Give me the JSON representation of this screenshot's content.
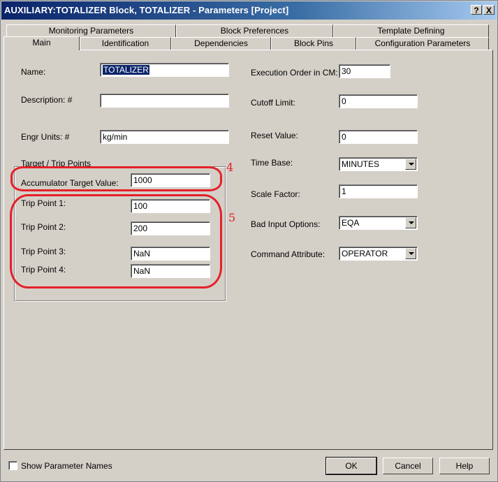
{
  "window": {
    "title": "AUXILIARY:TOTALIZER Block, TOTALIZER - Parameters [Project]",
    "help_button": "?",
    "close_button": "X"
  },
  "tabs": {
    "row_back": [
      "Monitoring Parameters",
      "Block Preferences",
      "Template Defining"
    ],
    "row_front": [
      "Main",
      "Identification",
      "Dependencies",
      "Block Pins",
      "Configuration Parameters"
    ],
    "active": "Main"
  },
  "left": {
    "name_label": "Name:",
    "name_value": "TOTALIZER",
    "description_label": "Description: #",
    "description_value": "",
    "engr_units_label": "Engr Units: #",
    "engr_units_value": "kg/min"
  },
  "target_trip": {
    "group_title": "Target / Trip Points",
    "accumulator_label": "Accumulator Target Value:",
    "accumulator_value": "1000",
    "trip_points": [
      {
        "label": "Trip Point 1:",
        "value": "100"
      },
      {
        "label": "Trip Point 2:",
        "value": "200"
      },
      {
        "label": "Trip Point 3:",
        "value": "NaN"
      },
      {
        "label": "Trip Point 4:",
        "value": "NaN"
      }
    ]
  },
  "right": {
    "exec_order_label": "Execution Order in CM:",
    "exec_order_value": "30",
    "cutoff_label": "Cutoff Limit:",
    "cutoff_value": "0",
    "reset_label": "Reset Value:",
    "reset_value": "0",
    "time_base_label": "Time Base:",
    "time_base_value": "MINUTES",
    "scale_factor_label": "Scale Factor:",
    "scale_factor_value": "1",
    "bad_input_label": "Bad Input Options:",
    "bad_input_value": "EQA",
    "command_attr_label": "Command Attribute:",
    "command_attr_value": "OPERATOR"
  },
  "annotations": {
    "mark_4": "4",
    "mark_5": "5",
    "color": "#e5202a"
  },
  "footer": {
    "show_param_names_label": "Show Parameter Names",
    "show_param_names_checked": false,
    "ok_label": "OK",
    "cancel_label": "Cancel",
    "help_label": "Help"
  }
}
